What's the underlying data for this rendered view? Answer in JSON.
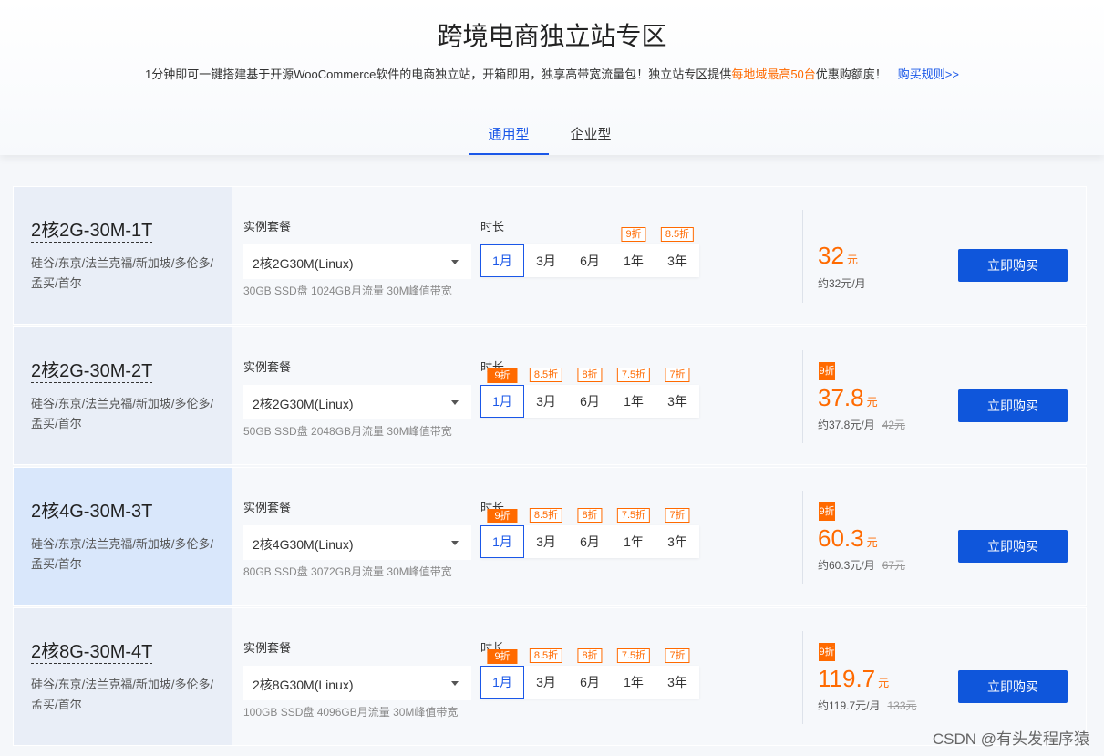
{
  "header": {
    "title": "跨境电商独立站专区",
    "subtitle_pre": "1分钟即可一键搭建基于开源WooCommerce软件的电商独立站，开箱即用，独享高带宽流量包！独立站专区提供",
    "subtitle_highlight": "每地域最高50台",
    "subtitle_post": "优惠购额度！",
    "rules_link": "购买规则>>"
  },
  "tabs": [
    {
      "label": "通用型",
      "active": true
    },
    {
      "label": "企业型",
      "active": false
    }
  ],
  "labels": {
    "package": "实例套餐",
    "duration": "时长",
    "buy": "立即购买",
    "currency_unit": "元"
  },
  "durations": [
    "1月",
    "3月",
    "6月",
    "1年",
    "3年"
  ],
  "products": [
    {
      "name": "2核2G-30M-1T",
      "regions": "硅谷/东京/法兰克福/新加坡/多伦多/孟买/首尔",
      "package": "2核2G30M(Linux)",
      "spec": "30GB SSD盘 1024GB月流量 30M峰值带宽",
      "tags": [
        "",
        "",
        "",
        "9折",
        "8.5折"
      ],
      "badge": "",
      "price": "32",
      "per_month": "约32元/月",
      "original": ""
    },
    {
      "name": "2核2G-30M-2T",
      "regions": "硅谷/东京/法兰克福/新加坡/多伦多/孟买/首尔",
      "package": "2核2G30M(Linux)",
      "spec": "50GB SSD盘 2048GB月流量 30M峰值带宽",
      "tags": [
        "9折",
        "8.5折",
        "8折",
        "7.5折",
        "7折"
      ],
      "badge": "9折",
      "price": "37.8",
      "per_month": "约37.8元/月",
      "original": "42元"
    },
    {
      "name": "2核4G-30M-3T",
      "regions": "硅谷/东京/法兰克福/新加坡/多伦多/孟买/首尔",
      "package": "2核4G30M(Linux)",
      "spec": "80GB SSD盘 3072GB月流量 30M峰值带宽",
      "tags": [
        "9折",
        "8.5折",
        "8折",
        "7.5折",
        "7折"
      ],
      "badge": "9折",
      "price": "60.3",
      "per_month": "约60.3元/月",
      "original": "67元"
    },
    {
      "name": "2核8G-30M-4T",
      "regions": "硅谷/东京/法兰克福/新加坡/多伦多/孟买/首尔",
      "package": "2核8G30M(Linux)",
      "spec": "100GB SSD盘 4096GB月流量 30M峰值带宽",
      "tags": [
        "9折",
        "8.5折",
        "8折",
        "7.5折",
        "7折"
      ],
      "badge": "9折",
      "price": "119.7",
      "per_month": "约119.7元/月",
      "original": "133元"
    }
  ],
  "watermark": "CSDN @有头发程序猿"
}
